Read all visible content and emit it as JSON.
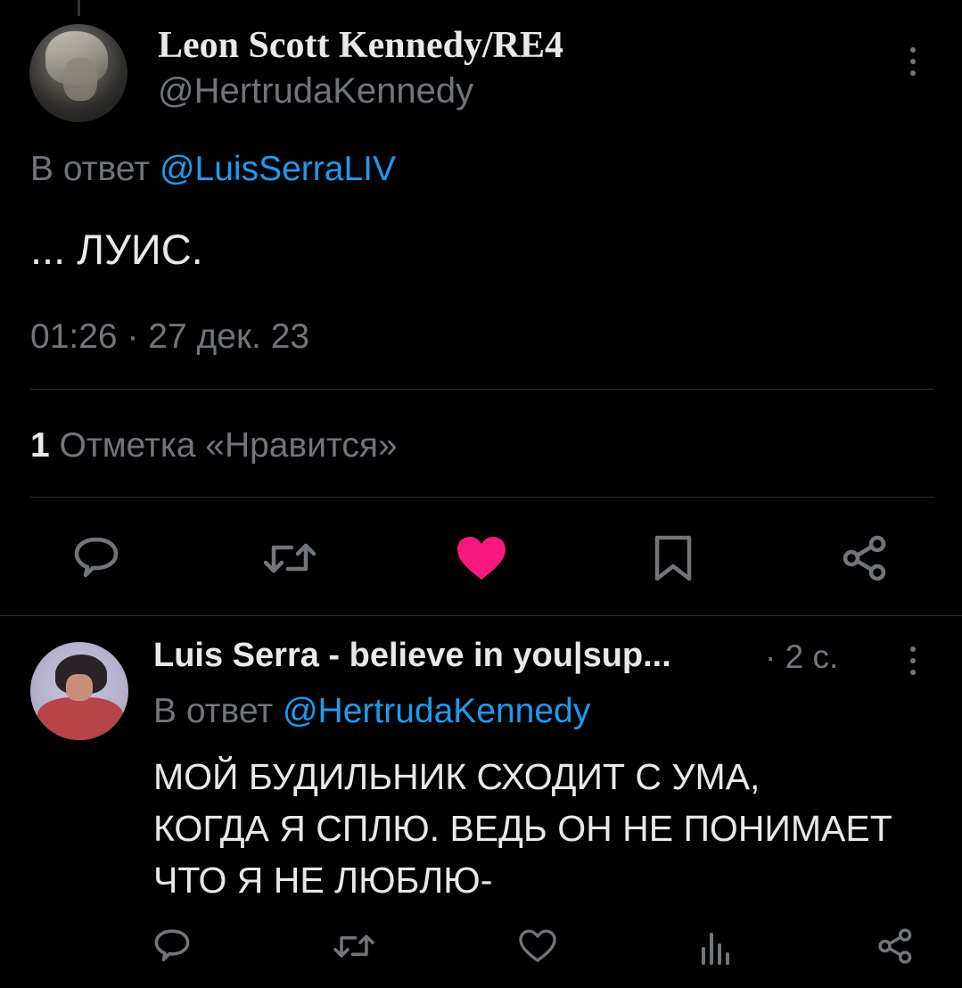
{
  "tweet": {
    "author_name": "Leon Scott Kennedy/RE4",
    "author_handle": "@HertrudaKennedy",
    "reply_prefix": "В ответ",
    "reply_mention": "@LuisSerraLIV",
    "text": "... ЛУИС.",
    "time": "01:26",
    "separator": "·",
    "date": "27 дек. 23",
    "likes_count": "1",
    "likes_label": "Отметка «Нравится»",
    "liked": true
  },
  "actions": {
    "icons": [
      "reply-icon",
      "retweet-icon",
      "like-icon",
      "bookmark-icon",
      "share-icon"
    ]
  },
  "reply": {
    "author_name": "Luis Serra - believe in you|sup...",
    "separator": "·",
    "time": "2 с.",
    "reply_prefix": "В ответ",
    "reply_mention": "@HertrudaKennedy",
    "lines": [
      "МОЙ БУДИЛЬНИК СХОДИТ С УМА,",
      "КОГДА Я СПЛЮ. ВЕДЬ ОН НЕ ПОНИМАЕТ",
      "ЧТО Я НЕ ЛЮБЛЮ-"
    ],
    "icons": [
      "reply-icon",
      "retweet-icon",
      "like-icon",
      "views-icon",
      "share-icon"
    ]
  },
  "colors": {
    "background": "#000000",
    "text": "#e7e9ea",
    "secondary": "#71767b",
    "link": "#1d9bf0",
    "like": "#f91880",
    "divider": "#2f3336"
  }
}
